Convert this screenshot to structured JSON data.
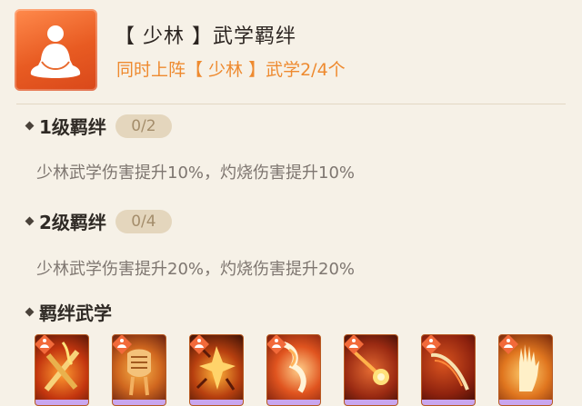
{
  "header": {
    "icon": "meditating-figure-icon",
    "title": "【 少林 】武学羁绊",
    "subtitle": "同时上阵【 少林 】武学2/4个"
  },
  "bonds": [
    {
      "title": "1级羁绊",
      "progress": "0/2",
      "description": "少林武学伤害提升10%，灼烧伤害提升10%"
    },
    {
      "title": "2级羁绊",
      "progress": "0/4",
      "description": "少林武学伤害提升20%，灼烧伤害提升20%"
    }
  ],
  "skills_section": {
    "title": "羁绊武学",
    "skills": [
      {
        "icon": "crossed-staff-skill-icon"
      },
      {
        "icon": "fist-skill-icon"
      },
      {
        "icon": "shattered-flame-skill-icon"
      },
      {
        "icon": "sweeping-fire-skill-icon"
      },
      {
        "icon": "fireball-skill-icon"
      },
      {
        "icon": "flaming-staff-skill-icon"
      },
      {
        "icon": "palm-skill-icon"
      }
    ]
  },
  "colors": {
    "accent_orange": "#ee8a2f",
    "icon_orange": "#e85b22",
    "badge_bg": "#e4d6bd",
    "skill_rarity": "#c9a6ee"
  }
}
